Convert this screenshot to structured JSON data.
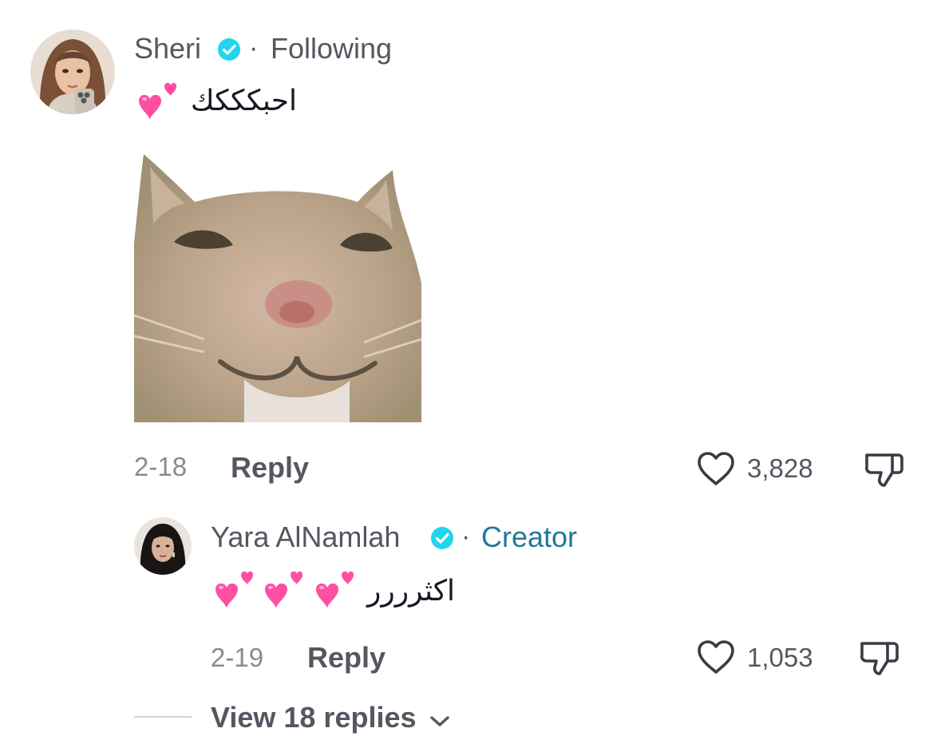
{
  "comment": {
    "author": "Sheri",
    "relation": "Following",
    "separator": "·",
    "text": "احبكككك",
    "date": "2-18",
    "reply_label": "Reply",
    "likes": "3,828"
  },
  "reply": {
    "author": "Yara AlNamlah",
    "relation": "Creator",
    "separator": "·",
    "text": "اكثرررر",
    "date": "2-19",
    "reply_label": "Reply",
    "likes": "1,053"
  },
  "view_replies_label": "View 18 replies",
  "colors": {
    "verified": "#20d5ec",
    "creator": "#20799a",
    "heart_emoji": "#ff4fa3"
  }
}
